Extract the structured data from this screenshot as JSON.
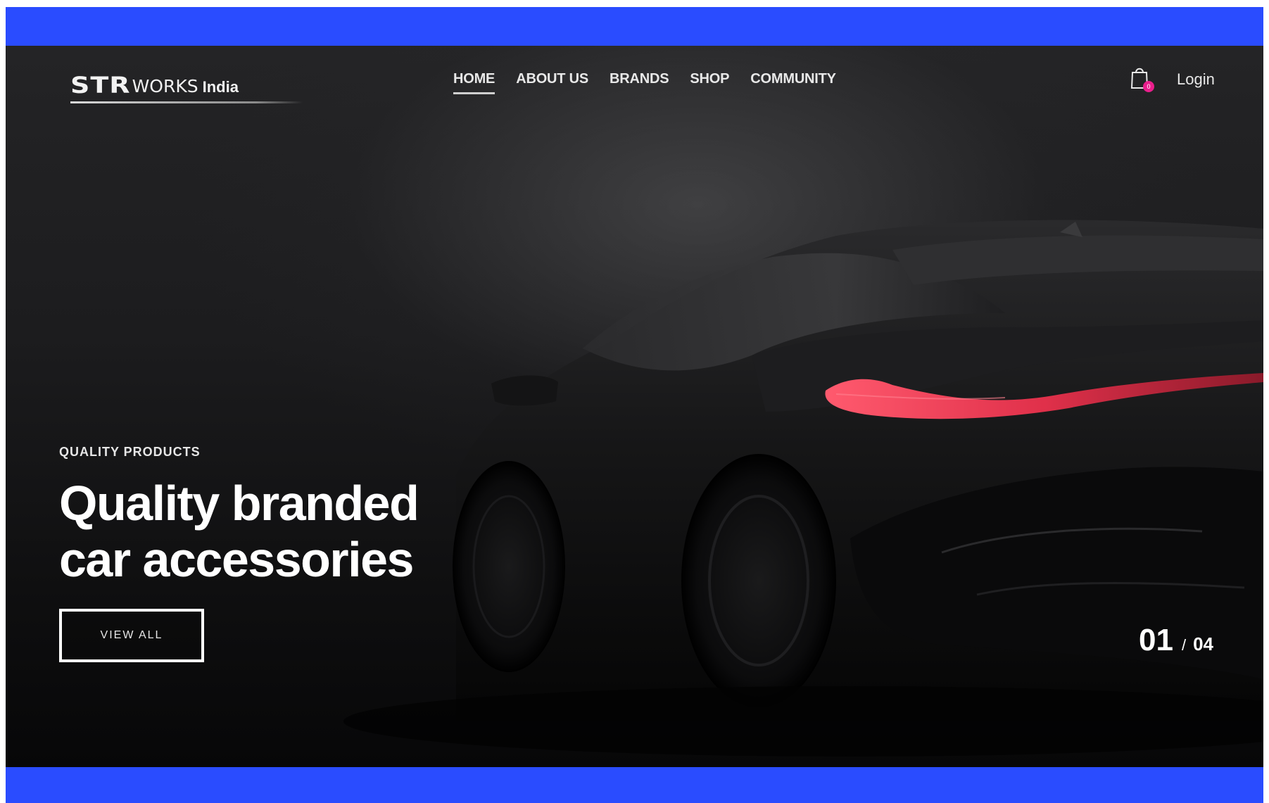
{
  "brand": {
    "logo_str": "STR",
    "logo_works": "works",
    "logo_country": "India"
  },
  "nav": {
    "items": [
      {
        "label": "HOME",
        "active": true
      },
      {
        "label": "ABOUT US",
        "active": false
      },
      {
        "label": "BRANDS",
        "active": false
      },
      {
        "label": "SHOP",
        "active": false
      },
      {
        "label": "COMMUNITY",
        "active": false
      }
    ],
    "cart_icon": "shopping-bag-icon",
    "cart_badge": "0",
    "login_label": "Login"
  },
  "hero": {
    "eyebrow": "QUALITY PRODUCTS",
    "headline": "Quality branded car accessories",
    "cta_label": "VIEW ALL",
    "slide_current": "01",
    "slide_separator": "/",
    "slide_total": "04"
  },
  "colors": {
    "frame": "#2a4cff",
    "hero_dark": "#1a1a1c",
    "taillight": "#e8324a",
    "badge": "#e91e8c"
  }
}
